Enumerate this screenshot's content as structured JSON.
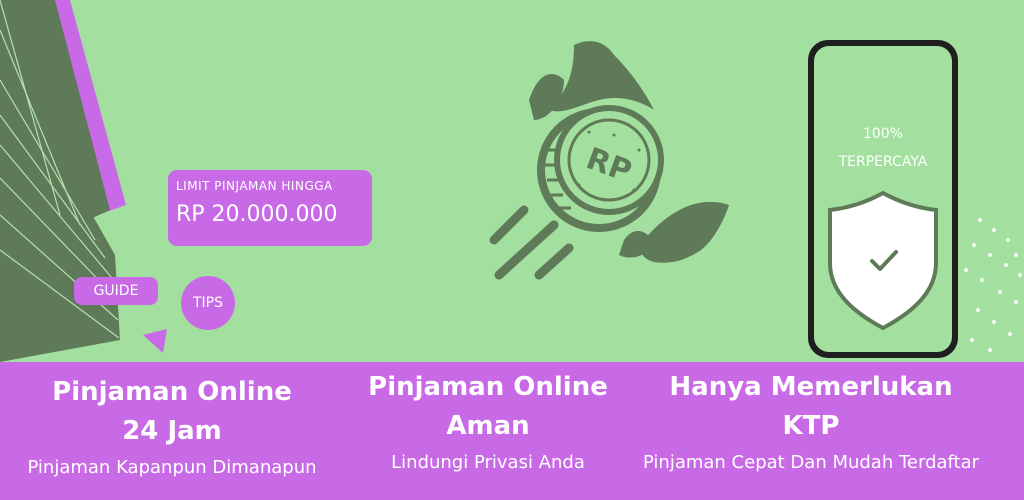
{
  "promo": {
    "limit_label": "LIMIT PINJAMAN HINGGA",
    "limit_amount": "RP 20.000.000",
    "guide_label": "GUIDE",
    "tips_label": "TIPS"
  },
  "logo": {
    "icon": "rupiah-coin-wings-icon",
    "coin_text": "RP"
  },
  "phone": {
    "trust_line1": "100%",
    "trust_line2": "TERPERCAYA",
    "icon": "shield-check-icon"
  },
  "features": [
    {
      "title1": "Pinjaman Online",
      "title2": "24 Jam",
      "subtitle": "Pinjaman Kapanpun Dimanapun"
    },
    {
      "title1": "Pinjaman Online",
      "title2": "Aman",
      "subtitle": "Lindungi Privasi Anda"
    },
    {
      "title1": "Hanya Memerlukan",
      "title2": "KTP",
      "subtitle": "Pinjaman Cepat Dan Mudah Terdaftar"
    }
  ],
  "colors": {
    "background": "#a3df9e",
    "accent_purple": "#c86ae6",
    "dark_green": "#5e7a58",
    "white": "#ffffff"
  }
}
